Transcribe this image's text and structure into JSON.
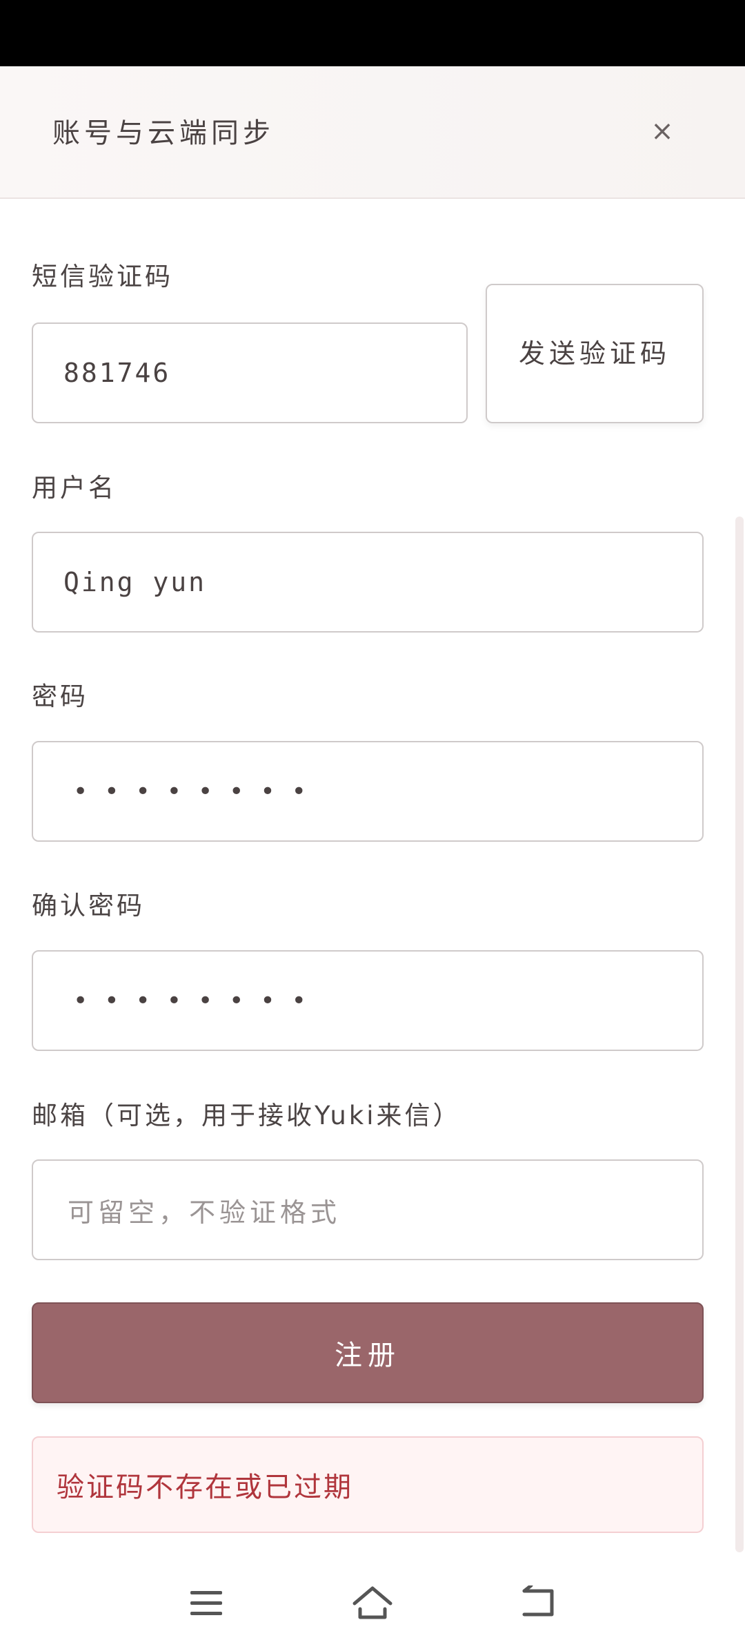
{
  "header": {
    "title": "账号与云端同步",
    "close_label": "×"
  },
  "form": {
    "sms_code": {
      "label": "短信验证码",
      "value": "881746",
      "send_button": "发送验证码"
    },
    "username": {
      "label": "用户名",
      "value": "Qing yun"
    },
    "password": {
      "label": "密码",
      "value": "••••••••"
    },
    "confirm_password": {
      "label": "确认密码",
      "value": "••••••••"
    },
    "email": {
      "label": "邮箱（可选，用于接收Yuki来信）",
      "value": "",
      "placeholder": "可留空，不验证格式"
    },
    "register_button": "注册",
    "error_message": "验证码不存在或已过期"
  },
  "colors": {
    "accent": "#9a666a",
    "error_text": "#b0353c",
    "error_bg": "#fff4f4"
  },
  "nav": {
    "menu_icon": "menu-icon",
    "home_icon": "home-icon",
    "back_icon": "back-icon"
  }
}
